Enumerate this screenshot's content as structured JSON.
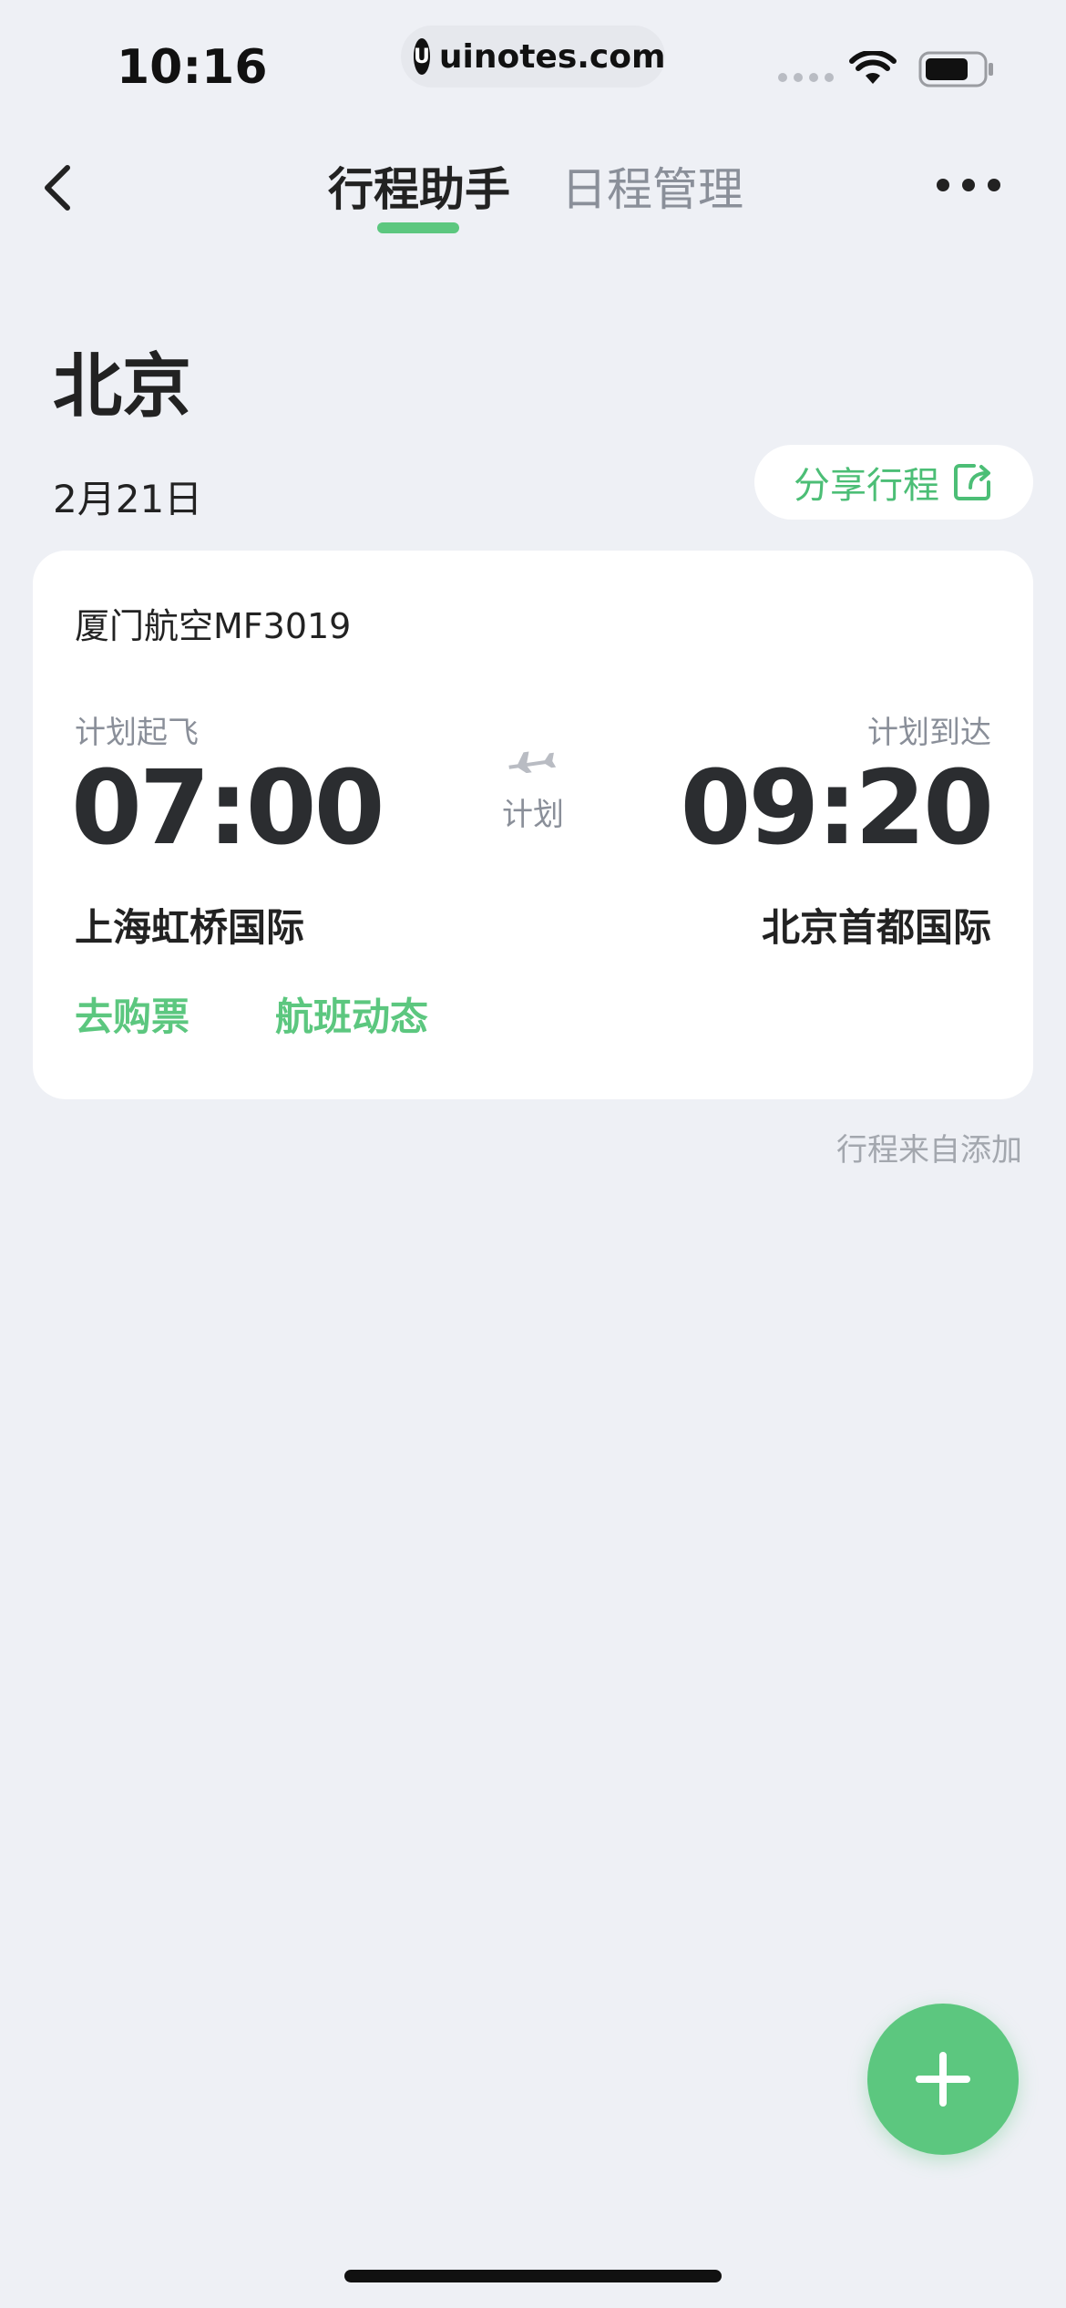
{
  "status_bar": {
    "time": "10:16",
    "url": "uinotes.com",
    "url_logo": "U"
  },
  "nav": {
    "tabs": [
      {
        "label": "行程助手",
        "active": true
      },
      {
        "label": "日程管理",
        "active": false
      }
    ],
    "back_icon": "chevron-left-icon",
    "more_icon": "more-horizontal-icon"
  },
  "header": {
    "city": "北京",
    "date": "2月21日",
    "share_label": "分享行程",
    "share_icon": "share-external-icon"
  },
  "flight": {
    "airline": "厦门航空MF3019",
    "departure": {
      "label": "计划起飞",
      "time": "07:00",
      "airport": "上海虹桥国际"
    },
    "arrival": {
      "label": "计划到达",
      "time": "09:20",
      "airport": "北京首都国际"
    },
    "status": "计划",
    "actions": {
      "buy": "去购票",
      "dynamics": "航班动态"
    }
  },
  "source_note": "行程来自添加",
  "fab_icon": "plus-icon",
  "colors": {
    "accent": "#5cc77f",
    "background": "#eef0f5",
    "card": "#ffffff",
    "muted": "#8a8f99"
  }
}
